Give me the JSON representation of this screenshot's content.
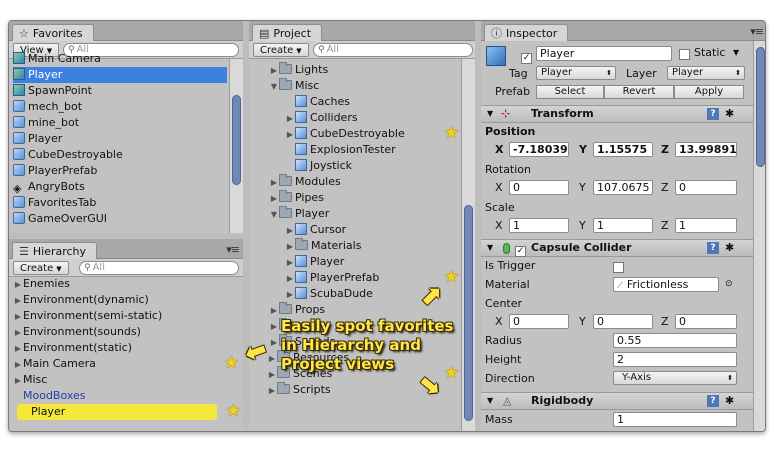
{
  "favorites": {
    "tab_label": "Favorites",
    "view_button": "View",
    "search_placeholder": "All",
    "items": [
      {
        "label": "Main Camera",
        "icon": "gameobject-icon"
      },
      {
        "label": "Player",
        "icon": "gameobject-icon",
        "selected": true
      },
      {
        "label": "SpawnPoint",
        "icon": "gameobject-icon"
      },
      {
        "label": "mech_bot",
        "icon": "script-icon"
      },
      {
        "label": "mine_bot",
        "icon": "script-icon"
      },
      {
        "label": "Player",
        "icon": "script-icon"
      },
      {
        "label": "CubeDestroyable",
        "icon": "script-icon"
      },
      {
        "label": "PlayerPrefab",
        "icon": "script-icon"
      },
      {
        "label": "AngryBots",
        "icon": "unity-icon"
      },
      {
        "label": "FavoritesTab",
        "icon": "script-icon"
      },
      {
        "label": "GameOverGUI",
        "icon": "script-icon"
      }
    ]
  },
  "hierarchy": {
    "tab_label": "Hierarchy",
    "create_button": "Create",
    "search_placeholder": "All",
    "items": [
      {
        "label": "Enemies",
        "expandable": true
      },
      {
        "label": "Environment(dynamic)",
        "expandable": true
      },
      {
        "label": "Environment(semi-static)",
        "expandable": true
      },
      {
        "label": "Environment(sounds)",
        "expandable": true
      },
      {
        "label": "Environment(static)",
        "expandable": true
      },
      {
        "label": "Main Camera",
        "expandable": true,
        "star": true
      },
      {
        "label": "Misc",
        "expandable": true
      },
      {
        "label": "MoodBoxes",
        "expandable": false,
        "link": true
      },
      {
        "label": "Player",
        "expandable": false,
        "highlight": true,
        "star": true
      }
    ]
  },
  "project": {
    "tab_label": "Project",
    "create_button": "Create",
    "search_placeholder": "All",
    "items": [
      {
        "label": "Lights",
        "type": "folder",
        "indent": 1,
        "arrow": "right"
      },
      {
        "label": "Misc",
        "type": "folder",
        "indent": 1,
        "arrow": "down"
      },
      {
        "label": "Caches",
        "type": "prefab",
        "indent": 2,
        "arrow": ""
      },
      {
        "label": "Colliders",
        "type": "prefab",
        "indent": 2,
        "arrow": "right"
      },
      {
        "label": "CubeDestroyable",
        "type": "prefab",
        "indent": 2,
        "arrow": "right",
        "star": true
      },
      {
        "label": "ExplosionTester",
        "type": "prefab",
        "indent": 2,
        "arrow": ""
      },
      {
        "label": "Joystick",
        "type": "prefab",
        "indent": 2,
        "arrow": ""
      },
      {
        "label": "Modules",
        "type": "folder",
        "indent": 1,
        "arrow": "right"
      },
      {
        "label": "Pipes",
        "type": "folder",
        "indent": 1,
        "arrow": "right"
      },
      {
        "label": "Player",
        "type": "folder",
        "indent": 1,
        "arrow": "down"
      },
      {
        "label": "Cursor",
        "type": "prefab",
        "indent": 2,
        "arrow": "right"
      },
      {
        "label": "Materials",
        "type": "folder",
        "indent": 2,
        "arrow": "right"
      },
      {
        "label": "Player",
        "type": "prefab",
        "indent": 2,
        "arrow": "right"
      },
      {
        "label": "PlayerPrefab",
        "type": "prefab",
        "indent": 2,
        "arrow": "right",
        "star": true
      },
      {
        "label": "ScubaDude",
        "type": "prefab",
        "indent": 2,
        "arrow": "right"
      },
      {
        "label": "Props",
        "type": "folder",
        "indent": 1,
        "arrow": "right"
      },
      {
        "label": "",
        "type": "folder",
        "indent": 1,
        "arrow": "right"
      },
      {
        "label": "Sounds",
        "type": "folder",
        "indent": 1,
        "arrow": "right"
      },
      {
        "label": "Resources",
        "type": "folder",
        "indent": 0,
        "arrow": "right"
      },
      {
        "label": "Scenes",
        "type": "folder",
        "indent": 0,
        "arrow": "right",
        "star": true
      },
      {
        "label": "Scripts",
        "type": "folder",
        "indent": 0,
        "arrow": "right"
      }
    ]
  },
  "inspector": {
    "tab_label": "Inspector",
    "object_name": "Player",
    "static_label": "Static",
    "tag_label": "Tag",
    "tag_value": "Player",
    "layer_label": "Layer",
    "layer_value": "Player",
    "prefab_label": "Prefab",
    "select_button": "Select",
    "revert_button": "Revert",
    "apply_button": "Apply",
    "transform": {
      "title": "Transform",
      "position_label": "Position",
      "position": {
        "x": "-7.18039",
        "y": "1.15575",
        "z": "13.99891"
      },
      "rotation_label": "Rotation",
      "rotation": {
        "x": "0",
        "y": "107.0675",
        "z": "0"
      },
      "scale_label": "Scale",
      "scale": {
        "x": "1",
        "y": "1",
        "z": "1"
      }
    },
    "capsule_collider": {
      "title": "Capsule Collider",
      "is_trigger_label": "Is Trigger",
      "material_label": "Material",
      "material_value": "Frictionless",
      "center_label": "Center",
      "center": {
        "x": "0",
        "y": "0",
        "z": "0"
      },
      "radius_label": "Radius",
      "radius_value": "0.55",
      "height_label": "Height",
      "height_value": "2",
      "direction_label": "Direction",
      "direction_value": "Y-Axis"
    },
    "rigidbody": {
      "title": "Rigidbody",
      "mass_label": "Mass",
      "mass_value": "1"
    },
    "axis_x": "X",
    "axis_y": "Y",
    "axis_z": "Z"
  },
  "callout": {
    "line1": "Easily spot favorites",
    "line2": "in Hierarchy and",
    "line3": "Project views"
  },
  "colors": {
    "selection": "#3d80df",
    "highlight": "#f5e83a",
    "star": "#f2d21a",
    "callout_text": "#ffe54a"
  }
}
